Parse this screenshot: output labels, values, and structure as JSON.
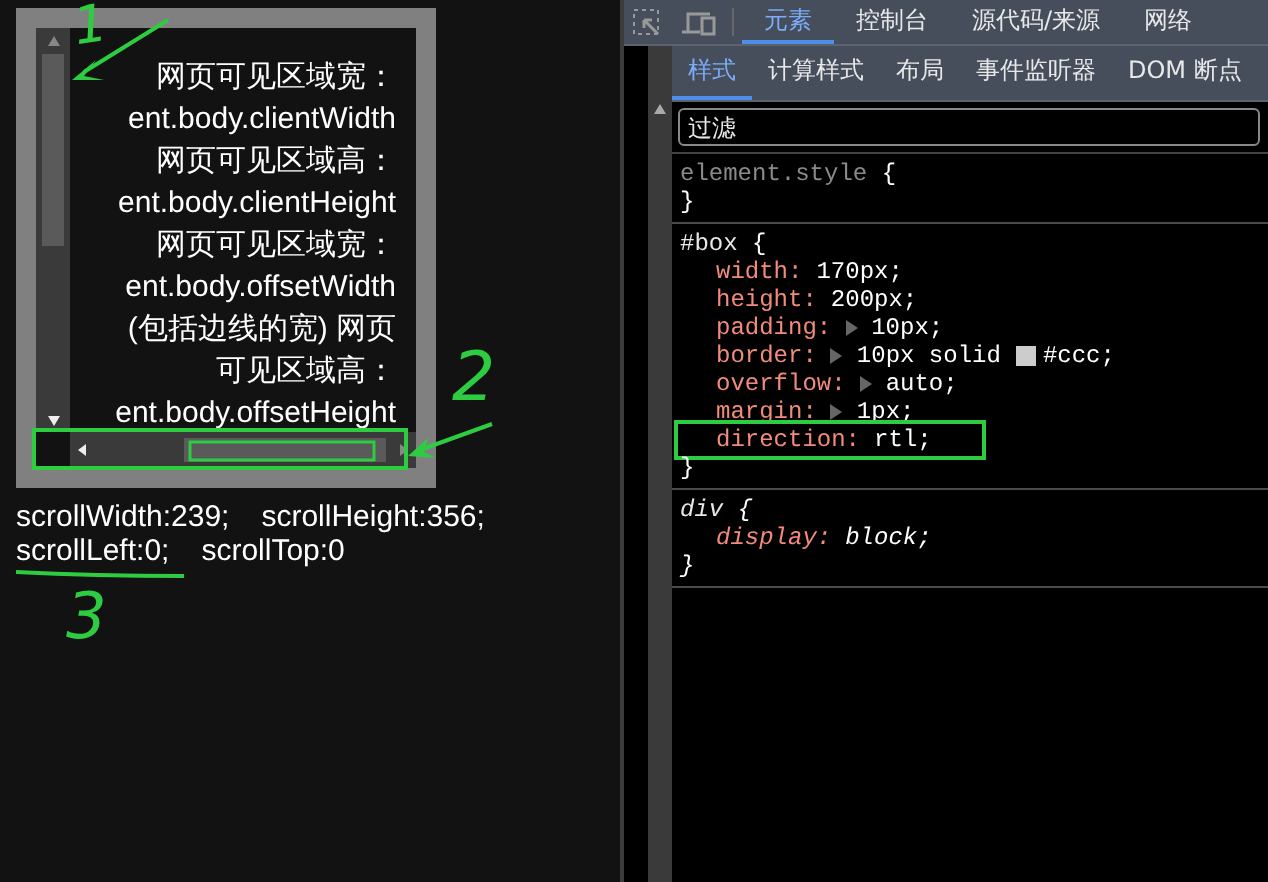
{
  "demo_box": {
    "lines": [
      "网页可见区域宽：",
      "ent.body.clientWidth",
      "网页可见区域高：",
      "ent.body.clientHeight",
      "网页可见区域宽：",
      "ent.body.offsetWidth",
      "(包括边线的宽) 网页",
      "可见区域高：",
      "ent.body.offsetHeight"
    ]
  },
  "readouts": [
    [
      "scrollWidth:239;",
      "scrollHeight:356;"
    ],
    [
      "scrollLeft:0;",
      "scrollTop:0"
    ]
  ],
  "annotations": [
    "1",
    "2",
    "3"
  ],
  "devtools": {
    "tabs": [
      {
        "label": "元素",
        "selected": true
      },
      {
        "label": "控制台",
        "selected": false
      },
      {
        "label": "源代码/来源",
        "selected": false
      },
      {
        "label": "网络",
        "selected": false
      }
    ],
    "subtabs": [
      {
        "label": "样式",
        "selected": true
      },
      {
        "label": "计算样式",
        "selected": false
      },
      {
        "label": "布局",
        "selected": false
      },
      {
        "label": "事件监听器",
        "selected": false
      },
      {
        "label": "DOM 断点",
        "selected": false
      }
    ],
    "filter": {
      "placeholder": "过滤"
    },
    "rules": [
      {
        "kind": "inline",
        "selector": "element.style",
        "open": "{",
        "close": "}"
      },
      {
        "kind": "id",
        "selector": "#box",
        "open": "{",
        "close": "}",
        "properties": [
          {
            "name": "width:",
            "value": "170px;",
            "expandable": false,
            "highlighted": false
          },
          {
            "name": "height:",
            "value": "200px;",
            "expandable": false,
            "highlighted": false
          },
          {
            "name": "padding:",
            "value": "10px;",
            "expandable": true,
            "highlighted": false
          },
          {
            "name": "border:",
            "value": "10px solid",
            "expandable": true,
            "color": "#cccccc",
            "color_value": "#ccc;",
            "highlighted": false
          },
          {
            "name": "overflow:",
            "value": "auto;",
            "expandable": true,
            "highlighted": false
          },
          {
            "name": "margin:",
            "value": "1px;",
            "expandable": true,
            "highlighted": false
          },
          {
            "name": "direction:",
            "value": "rtl;",
            "expandable": false,
            "highlighted": true
          }
        ]
      },
      {
        "kind": "tag",
        "selector": "div",
        "open": "{",
        "close": "}",
        "properties": [
          {
            "name": "display:",
            "value": "block;",
            "expandable": false,
            "highlighted": false
          }
        ]
      }
    ]
  }
}
